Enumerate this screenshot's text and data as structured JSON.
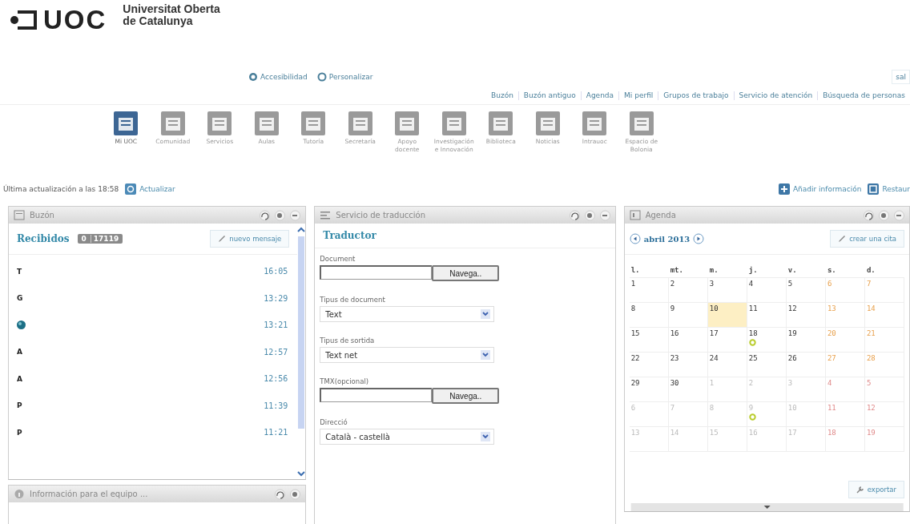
{
  "header": {
    "logo": "UOC",
    "university": [
      "Universitat Oberta",
      "de Catalunya"
    ],
    "utility_links": [
      {
        "label": "Accesibilidad",
        "kind": "accessibility"
      },
      {
        "label": "Personalizar",
        "kind": "personalize"
      }
    ],
    "logout": "sal",
    "nav_links": [
      "Buzón",
      "Buzón antiguo",
      "Agenda",
      "Mi perfil",
      "Grupos de trabajo",
      "Servicio de atención",
      "Búsqueda de personas"
    ],
    "apps": [
      {
        "label": "Mi UOC",
        "selected": true
      },
      {
        "label": "Comunidad",
        "selected": false
      },
      {
        "label": "Servicios",
        "selected": false
      },
      {
        "label": "Aulas",
        "selected": false
      },
      {
        "label": "Tutoría",
        "selected": false
      },
      {
        "label": "Secretaría",
        "selected": false
      },
      {
        "label": "Apoyo docente",
        "selected": false
      },
      {
        "label": "Investigación e Innovación",
        "selected": false
      },
      {
        "label": "Biblioteca",
        "selected": false
      },
      {
        "label": "Noticias",
        "selected": false
      },
      {
        "label": "Intrauoc",
        "selected": false
      },
      {
        "label": "Espacio de Bolonia",
        "selected": false
      }
    ]
  },
  "toolbar": {
    "last_update": "Última actualización a las 18:58",
    "refresh": "Actualizar",
    "add_info": "Añadir información",
    "restore": "Restaur"
  },
  "mailbox": {
    "title": "Buzón",
    "controls": [
      {
        "kind": "refresh"
      },
      {
        "kind": "settings"
      },
      {
        "kind": "minimize"
      }
    ],
    "folder": "Recibidos",
    "unread": "0",
    "total": "17119",
    "new_message": "nuevo mensaje",
    "messages": [
      {
        "kind": "letter",
        "sender": "T",
        "time": "16:05"
      },
      {
        "kind": "letter",
        "sender": "G",
        "time": "13:29"
      },
      {
        "kind": "globe",
        "time": "13:21"
      },
      {
        "kind": "letter",
        "sender": "A",
        "time": "12:57"
      },
      {
        "kind": "letter",
        "sender": "A",
        "time": "12:56"
      },
      {
        "kind": "letter",
        "sender": "P",
        "time": "11:39"
      },
      {
        "kind": "letter",
        "sender": "P",
        "time": "11:21"
      }
    ]
  },
  "team_info": {
    "title": "Información para el equipo ...",
    "controls": [
      {
        "kind": "refresh"
      },
      {
        "kind": "settings"
      }
    ]
  },
  "translation": {
    "title": "Servicio de traducción",
    "controls": [
      {
        "kind": "refresh"
      },
      {
        "kind": "settings"
      },
      {
        "kind": "minimize"
      }
    ],
    "heading": "Traductor",
    "fields": [
      {
        "kind": "file",
        "label": "Document",
        "button": "Navega.."
      },
      {
        "kind": "select",
        "label": "Tipus de document",
        "value": "Text"
      },
      {
        "kind": "select",
        "label": "Tipus de sortida",
        "value": "Text net"
      },
      {
        "kind": "file",
        "label": "TMX(opcional)",
        "button": "Navega.."
      },
      {
        "kind": "select",
        "label": "Direcció",
        "value": "Català - castellà"
      }
    ]
  },
  "agenda": {
    "title": "Agenda",
    "controls": [
      {
        "kind": "refresh"
      },
      {
        "kind": "settings"
      },
      {
        "kind": "minimize"
      }
    ],
    "month": "abril 2013",
    "new_event": "crear una cita",
    "export": "exportar",
    "weekdays": [
      "l.",
      "mt.",
      "m.",
      "j.",
      "v.",
      "s.",
      "d."
    ],
    "weeks": [
      [
        {
          "day": "1",
          "kind": "in"
        },
        {
          "day": "2",
          "kind": "in"
        },
        {
          "day": "3",
          "kind": "in"
        },
        {
          "day": "4",
          "kind": "in"
        },
        {
          "day": "5",
          "kind": "in"
        },
        {
          "day": "6",
          "kind": "in"
        },
        {
          "day": "7",
          "kind": "in"
        }
      ],
      [
        {
          "day": "8",
          "kind": "in"
        },
        {
          "day": "9",
          "kind": "in"
        },
        {
          "day": "10",
          "kind": "in",
          "today": true
        },
        {
          "day": "11",
          "kind": "in"
        },
        {
          "day": "12",
          "kind": "in"
        },
        {
          "day": "13",
          "kind": "in"
        },
        {
          "day": "14",
          "kind": "in"
        }
      ],
      [
        {
          "day": "15",
          "kind": "in"
        },
        {
          "day": "16",
          "kind": "in"
        },
        {
          "day": "17",
          "kind": "in"
        },
        {
          "day": "18",
          "kind": "in",
          "event": true
        },
        {
          "day": "19",
          "kind": "in"
        },
        {
          "day": "20",
          "kind": "in"
        },
        {
          "day": "21",
          "kind": "in"
        }
      ],
      [
        {
          "day": "22",
          "kind": "in"
        },
        {
          "day": "23",
          "kind": "in"
        },
        {
          "day": "24",
          "kind": "in"
        },
        {
          "day": "25",
          "kind": "in"
        },
        {
          "day": "26",
          "kind": "in"
        },
        {
          "day": "27",
          "kind": "in"
        },
        {
          "day": "28",
          "kind": "in"
        }
      ],
      [
        {
          "day": "29",
          "kind": "in"
        },
        {
          "day": "30",
          "kind": "in"
        },
        {
          "day": "1",
          "kind": "out"
        },
        {
          "day": "2",
          "kind": "out"
        },
        {
          "day": "3",
          "kind": "out"
        },
        {
          "day": "4",
          "kind": "out"
        },
        {
          "day": "5",
          "kind": "out"
        }
      ],
      [
        {
          "day": "6",
          "kind": "out"
        },
        {
          "day": "7",
          "kind": "out"
        },
        {
          "day": "8",
          "kind": "out"
        },
        {
          "day": "9",
          "kind": "out",
          "event": true
        },
        {
          "day": "10",
          "kind": "out"
        },
        {
          "day": "11",
          "kind": "out"
        },
        {
          "day": "12",
          "kind": "out"
        }
      ],
      [
        {
          "day": "13",
          "kind": "out"
        },
        {
          "day": "14",
          "kind": "out"
        },
        {
          "day": "15",
          "kind": "out"
        },
        {
          "day": "16",
          "kind": "out"
        },
        {
          "day": "17",
          "kind": "out"
        },
        {
          "day": "18",
          "kind": "out"
        },
        {
          "day": "19",
          "kind": "out"
        }
      ]
    ]
  }
}
